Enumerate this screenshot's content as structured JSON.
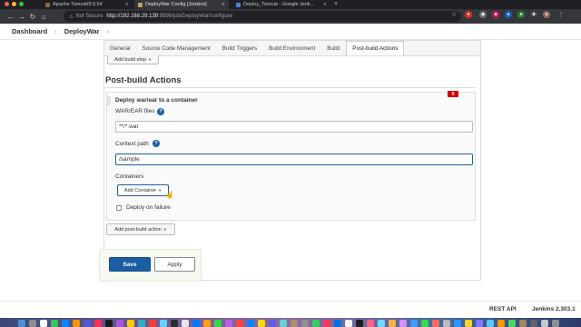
{
  "browser": {
    "tabs": [
      {
        "title": "Apache Tomcat/9.0.54",
        "active": false
      },
      {
        "title": "DeployWar Config [Jenkins]",
        "active": true
      },
      {
        "title": "Deploy_Tomcat - Google Jenk...",
        "active": false
      }
    ],
    "address": {
      "security_label": "Not Secure",
      "host": "http://192.168.29.139",
      "path": ":9999/job/DeployWar/configure"
    },
    "window_controls": {
      "close_color": "#ff5f57",
      "minimize_color": "#febc2e",
      "maximize_color": "#28c840"
    }
  },
  "breadcrumb": {
    "items": [
      "Dashboard",
      "DeployWar"
    ]
  },
  "config_tabs": [
    {
      "label": "General",
      "active": false
    },
    {
      "label": "Source Code Management",
      "active": false
    },
    {
      "label": "Build Triggers",
      "active": false
    },
    {
      "label": "Build Environment",
      "active": false
    },
    {
      "label": "Build",
      "active": false
    },
    {
      "label": "Post-build Actions",
      "active": true
    }
  ],
  "build": {
    "add_build_step_label": "Add build step"
  },
  "post_build": {
    "section_title": "Post-build Actions",
    "delete_label": "X",
    "box_title": "Deploy war/ear to a container",
    "war_files_label": "WAR/EAR files",
    "war_files_value": "**/*.war",
    "context_path_label": "Context path",
    "context_path_value": "/sample",
    "containers_label": "Containers",
    "add_container_label": "Add Container",
    "deploy_on_failure_label": "Deploy on failure",
    "deploy_on_failure_checked": false,
    "add_post_build_label": "Add post-build action",
    "help_glyph": "?"
  },
  "actions": {
    "save_label": "Save",
    "apply_label": "Apply"
  },
  "footer": {
    "rest_api_label": "REST API",
    "version_label": "Jenkins 2.303.1"
  },
  "colors": {
    "accent": "#1a5ea6",
    "danger": "#cc0000"
  }
}
